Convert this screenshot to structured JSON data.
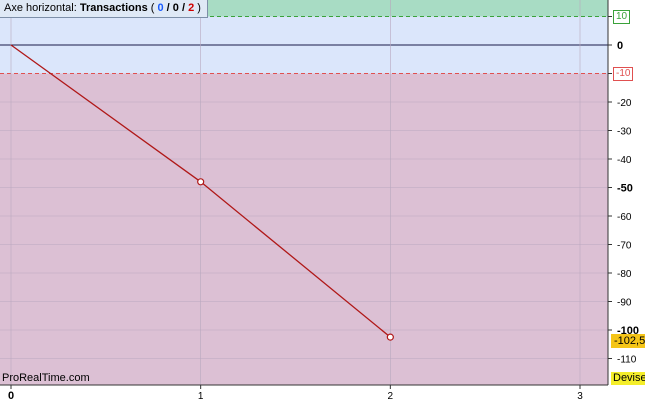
{
  "header": {
    "prefix": "Axe horizontal:",
    "title": "Transactions",
    "open_paren": "(",
    "count_blue": "0",
    "sep1": "/",
    "count_dark": "0",
    "sep2": "/",
    "count_red": "2",
    "close_paren": ")"
  },
  "watermark": "ProRealTime.com",
  "devise_label": "Devise",
  "last_value_label": "-102,5",
  "upper_band_label": "10",
  "lower_band_label": "-10",
  "colors": {
    "green_zone": "#a8dcc4",
    "blue_zone": "#dbe6fb",
    "red_zone": "#dcc0d4",
    "line": "#b01818",
    "last_value_bg": "#f5c518",
    "devise_bg": "#f4ee2a"
  },
  "chart_data": {
    "type": "line",
    "x": [
      0,
      1,
      2
    ],
    "y": [
      0,
      -48,
      -102.5
    ],
    "xlim": [
      0,
      3
    ],
    "ylim": [
      -115,
      15
    ],
    "x_ticks": [
      "0",
      "1",
      "2",
      "3"
    ],
    "y_ticks": [
      "10",
      "0",
      "-10",
      "-20",
      "-30",
      "-40",
      "-50",
      "-60",
      "-70",
      "-80",
      "-90",
      "-100",
      "-110"
    ],
    "bold_y_ticks": [
      "0",
      "-50",
      "-100"
    ],
    "upper_band": 10,
    "lower_band": -10,
    "last_value": -102.5
  }
}
